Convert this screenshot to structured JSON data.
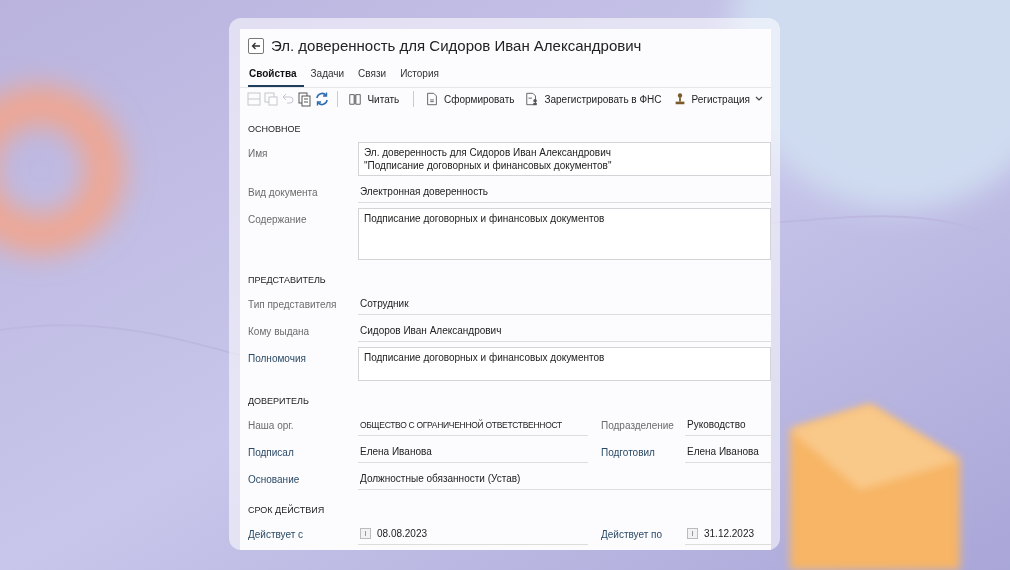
{
  "window": {
    "title": "Эл. доверенность для Сидоров Иван Александрович"
  },
  "tabs": [
    {
      "label": "Свойства",
      "selected": true
    },
    {
      "label": "Задачи",
      "selected": false
    },
    {
      "label": "Связи",
      "selected": false
    },
    {
      "label": "История",
      "selected": false
    }
  ],
  "toolbar": [
    {
      "kind": "icon",
      "disabled": true
    },
    {
      "kind": "icon",
      "disabled": true
    },
    {
      "kind": "icon",
      "disabled": true
    },
    {
      "kind": "icon",
      "disabled": false
    },
    {
      "kind": "icon",
      "disabled": false
    },
    {
      "kind": "separator"
    },
    {
      "kind": "button",
      "label": "Читать"
    },
    {
      "kind": "separator"
    },
    {
      "kind": "button",
      "label": "Сформировать"
    },
    {
      "kind": "button",
      "label": "Зарегистрировать в ФНС"
    },
    {
      "kind": "menu",
      "label": "Регистрация"
    }
  ],
  "sections": [
    {
      "title": "ОСНОВНОЕ",
      "rows": [
        {
          "fields": [
            {
              "label": "Имя",
              "link": false,
              "kind": "box",
              "lines": [
                "Эл. доверенность для Сидоров Иван Александрович",
                "\"Подписание договорных и финансовых документов\""
              ]
            }
          ]
        },
        {
          "fields": [
            {
              "label": "Вид документа",
              "link": false,
              "kind": "line",
              "value": "Электронная доверенность"
            }
          ]
        },
        {
          "fields": [
            {
              "label": "Содержание",
              "link": false,
              "kind": "tallbox",
              "lines": [
                "Подписание договорных и финансовых документов"
              ]
            }
          ]
        }
      ]
    },
    {
      "title": "ПРЕДСТАВИТЕЛЬ",
      "rows": [
        {
          "fields": [
            {
              "label": "Тип представителя",
              "link": false,
              "kind": "line",
              "value": "Сотрудник"
            }
          ]
        },
        {
          "fields": [
            {
              "label": "Кому выдана",
              "link": false,
              "kind": "line",
              "value": "Сидоров Иван Александрович"
            }
          ]
        },
        {
          "fields": [
            {
              "label": "Полномочия",
              "link": true,
              "kind": "box",
              "lines": [
                "Подписание договорных и финансовых документов"
              ]
            }
          ]
        }
      ]
    },
    {
      "title": "ДОВЕРИТЕЛЬ",
      "rows": [
        {
          "fields": [
            {
              "label": "Наша орг.",
              "link": false,
              "kind": "line",
              "value": "ОБЩЕСТВО С ОГРАНИЧЕННОЙ ОТВЕТСТВЕННОСТ"
            },
            {
              "label": "Подразделение",
              "link": false,
              "kind": "line",
              "value": "Руководство"
            }
          ]
        },
        {
          "fields": [
            {
              "label": "Подписал",
              "link": true,
              "kind": "line",
              "value": "Елена Иванова"
            },
            {
              "label": "Подготовил",
              "link": true,
              "kind": "line",
              "value": "Елена Иванова"
            }
          ]
        },
        {
          "fields": [
            {
              "label": "Основание",
              "link": true,
              "kind": "line",
              "value": "Должностные обязанности (Устав)"
            }
          ]
        }
      ]
    },
    {
      "title": "СРОК ДЕЙСТВИЯ",
      "rows": [
        {
          "fields": [
            {
              "label": "Действует с",
              "link": true,
              "kind": "date",
              "value": "08.08.2023"
            },
            {
              "label": "Действует по",
              "link": true,
              "kind": "date",
              "value": "31.12.2023"
            }
          ]
        }
      ]
    }
  ]
}
